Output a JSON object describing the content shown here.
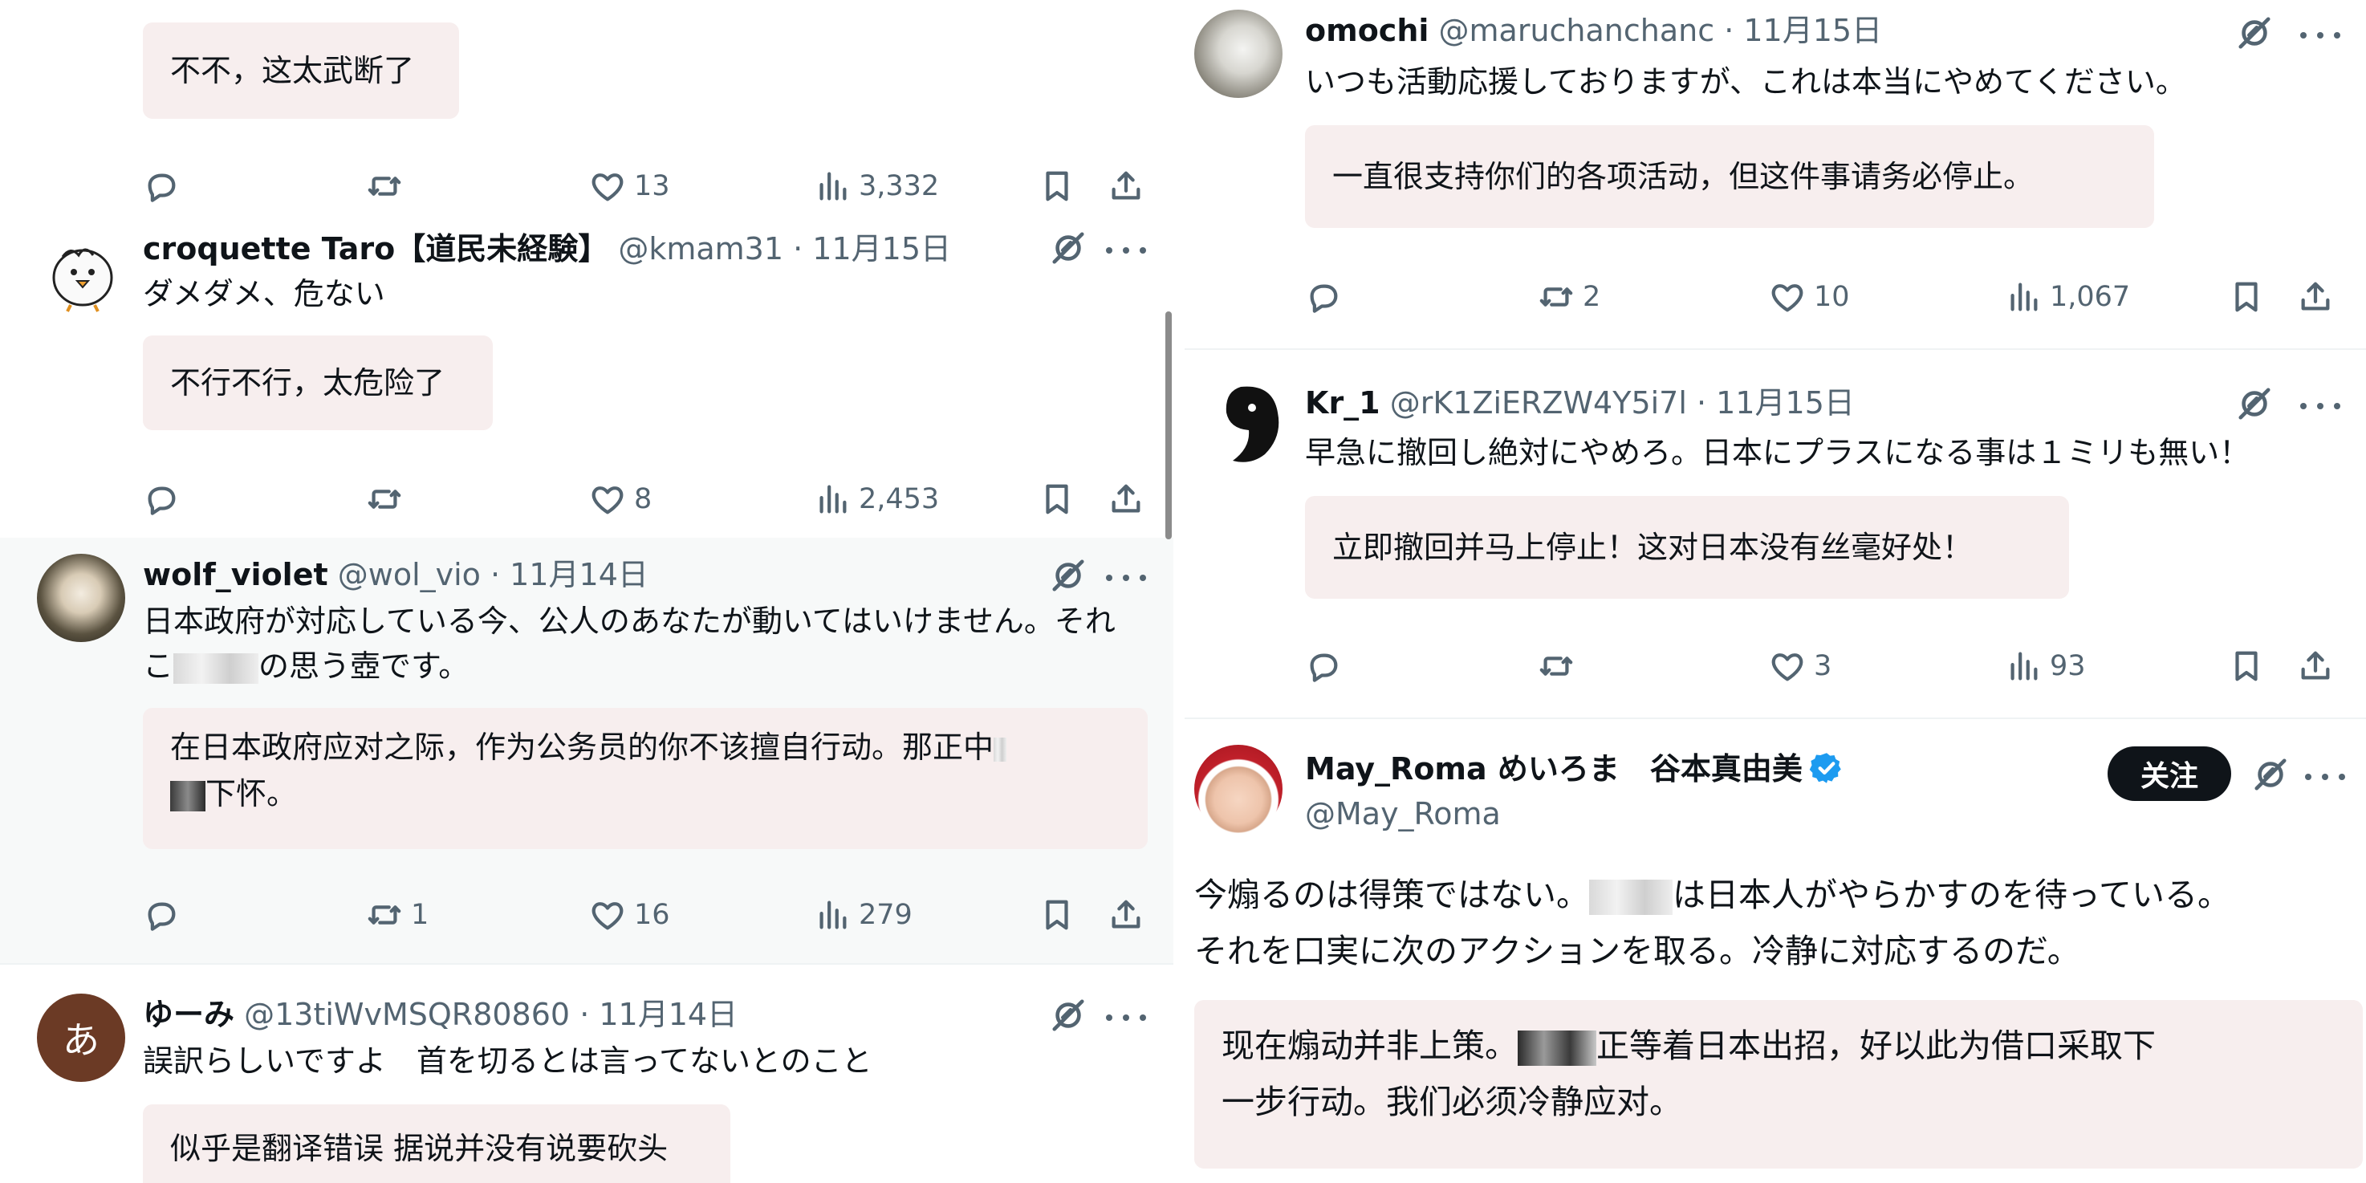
{
  "left": {
    "top_tweet": {
      "translation": "不不，这太武断了",
      "actions": {
        "like_count": "13",
        "views_count": "3,332"
      }
    },
    "tweets": [
      {
        "name": "croquette Taro【道民未経験】",
        "handle": "@kmam31",
        "date": "· 11月15日",
        "text": "ダメダメ、危ない",
        "translation": "不行不行，太危险了",
        "actions": {
          "like_count": "8",
          "views_count": "2,453"
        }
      },
      {
        "name": "wolf_violet",
        "handle": "@wol_vio",
        "date": "· 11月14日",
        "text_line1": "日本政府が対応している今、公人のあなたが動いてはいけません。それ",
        "text_line2_start": "こ",
        "text_line2_end": "の思う壺です。",
        "translation_line1": "在日本政府应对之际，作为公务员的你不该擅自行动。那正中",
        "translation_line2": "下怀。",
        "actions": {
          "retweet_count": "1",
          "like_count": "16",
          "views_count": "279"
        }
      },
      {
        "name": "ゆーみ",
        "handle": "@13tiWvMSQR80860",
        "date": "· 11月14日",
        "avatar_letter": "あ",
        "text": "誤訳らしいですよ　首を切るとは言ってないとのこと",
        "translation": "似乎是翻译错误 据说并没有说要砍头"
      }
    ]
  },
  "right": {
    "tweets": [
      {
        "name": "omochi",
        "handle": "@maruchanchanc",
        "date": "· 11月15日",
        "text": "いつも活動応援しておりますが、これは本当にやめてください。",
        "translation": "一直很支持你们的各项活动，但这件事请务必停止。",
        "actions": {
          "retweet_count": "2",
          "like_count": "10",
          "views_count": "1,067"
        }
      },
      {
        "name": "Kr_1",
        "handle": "@rK1ZiERZW4Y5i7l",
        "date": "· 11月15日",
        "text": "早急に撤回し絶対にやめろ。日本にプラスになる事は１ミリも無い！",
        "translation": "立即撤回并马上停止！这对日本没有丝毫好处！",
        "actions": {
          "like_count": "3",
          "views_count": "93"
        }
      },
      {
        "name": "May_Roma めいろま　谷本真由美",
        "handle": "@May_Roma",
        "follow_label": "关注",
        "text_line1_start": "今煽るのは得策ではない。",
        "text_line1_end": "は日本人がやらかすのを待っている。",
        "text_line2": "それを口実に次のアクションを取る。冷静に対応するのだ。",
        "translation_line1_start": "现在煽动并非上策。",
        "translation_line1_end": "正等着日本出招，好以此为借口采取下",
        "translation_line2": "一步行动。我们必须冷静应对。"
      }
    ]
  },
  "colors": {
    "text": "#0f1419",
    "secondary": "#536471",
    "translation_bg": "#f7eeee",
    "verified": "#1d9bf0"
  },
  "icons": [
    "reply-icon",
    "retweet-icon",
    "like-icon",
    "views-icon",
    "bookmark-icon",
    "share-icon",
    "grok-icon",
    "more-icon",
    "verified-icon"
  ]
}
